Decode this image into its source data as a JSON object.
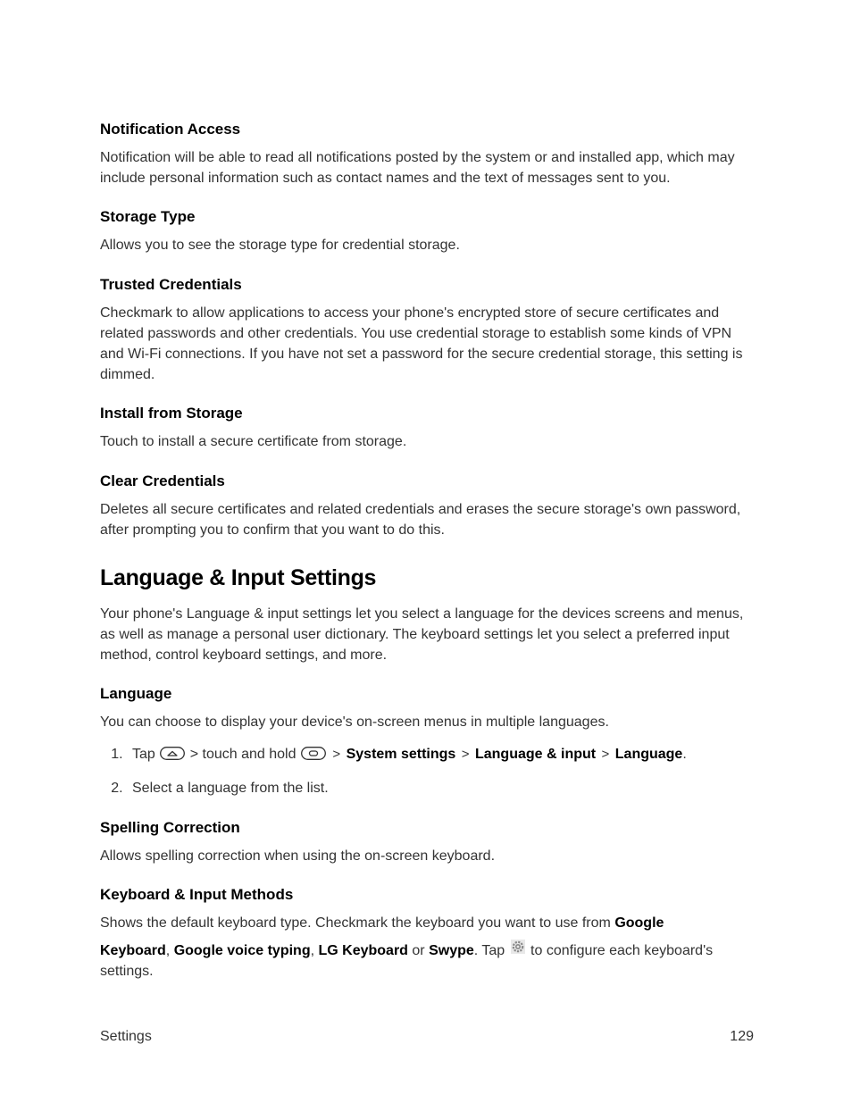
{
  "sections": {
    "notificationAccess": {
      "heading": "Notification Access",
      "body": "Notification will be able to read all notifications posted by the system or and installed app, which may include personal information such as contact names and the text of messages sent to you."
    },
    "storageType": {
      "heading": "Storage Type",
      "body": "Allows you to see the storage type for credential storage."
    },
    "trustedCredentials": {
      "heading": "Trusted Credentials",
      "body": "Checkmark to allow applications to access your phone's encrypted store of secure certificates and related passwords and other credentials. You use credential storage to establish some kinds of VPN and Wi-Fi connections. If you have not set a password for the secure credential storage, this setting is dimmed."
    },
    "installFromStorage": {
      "heading": "Install from Storage",
      "body": "Touch to install a secure certificate from storage."
    },
    "clearCredentials": {
      "heading": "Clear Credentials",
      "body": "Deletes all secure certificates and related credentials and erases the secure storage's own password, after prompting you to confirm that you want to do this."
    },
    "languageInputSettings": {
      "heading": "Language & Input Settings",
      "body": "Your phone's Language & input settings let you select a language for the devices screens and menus, as well as manage a personal user dictionary. The keyboard settings let you select a preferred input method, control keyboard settings, and more."
    },
    "language": {
      "heading": "Language",
      "body": "You can choose to display your device's on-screen menus in multiple languages.",
      "step1": {
        "tap": "Tap",
        "touchHold": "> touch and hold",
        "gt1": ">",
        "systemSettings": "System settings",
        "gt2": ">",
        "languageInput": "Language & input",
        "gt3": ">",
        "languageBold": "Language",
        "period": "."
      },
      "step2": "Select a language from the list."
    },
    "spellingCorrection": {
      "heading": "Spelling Correction",
      "body": "Allows spelling correction when using the on-screen keyboard."
    },
    "keyboardInputMethods": {
      "heading": "Keyboard & Input Methods",
      "body": {
        "part1": "Shows the default keyboard type. Checkmark the keyboard you want to use from ",
        "google": "Google",
        "keyboard": "Keyboard",
        "comma1": ", ",
        "googleVoice": "Google voice typing",
        "comma2": ", ",
        "lgKeyboard": "LG Keyboard",
        "or": " or ",
        "swype": "Swype",
        "tapPart": ". Tap ",
        "endPart": " to configure each keyboard's settings."
      }
    }
  },
  "footer": {
    "left": "Settings",
    "right": "129"
  }
}
